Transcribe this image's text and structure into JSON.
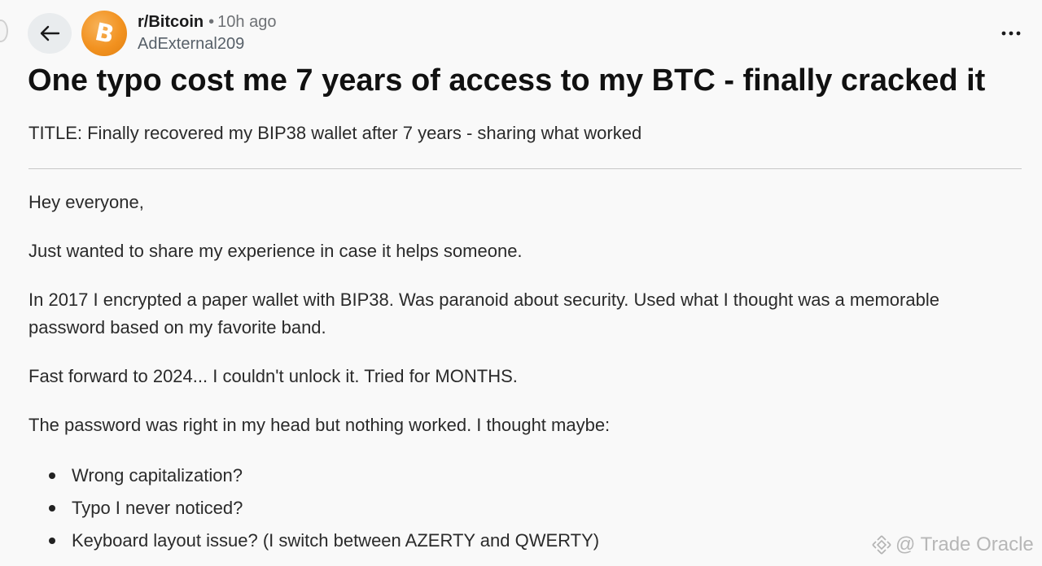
{
  "header": {
    "subreddit": "r/Bitcoin",
    "separator": "•",
    "time_ago": "10h ago",
    "author": "AdExternal209",
    "avatar_icon": "bitcoin-icon",
    "avatar_glyph": "B",
    "back_icon": "arrow-left-icon",
    "more_icon": "more-horizontal-icon"
  },
  "post": {
    "title": "One typo cost me 7 years of access to my BTC - finally cracked it",
    "subtitle": "TITLE: Finally recovered my BIP38 wallet after 7 years - sharing what worked",
    "paragraphs": [
      "Hey everyone,",
      "Just wanted to share my experience in case it helps someone.",
      "In 2017 I encrypted a paper wallet with BIP38. Was paranoid about security. Used what I thought was a memorable password based on my favorite band.",
      "Fast forward to 2024... I couldn't unlock it. Tried for MONTHS.",
      "The password was right in my head but nothing worked. I thought maybe:"
    ],
    "bullets": [
      "Wrong capitalization?",
      "Typo I never noticed?",
      "Keyboard layout issue? (I switch between AZERTY and QWERTY)"
    ]
  },
  "watermark": {
    "text": "@ Trade Oracle",
    "icon": "binance-logo-icon"
  },
  "colors": {
    "background": "#f9f9f9",
    "avatar": "#f29220",
    "divider": "#c8c8c8",
    "muted_text": "#6e7175"
  }
}
